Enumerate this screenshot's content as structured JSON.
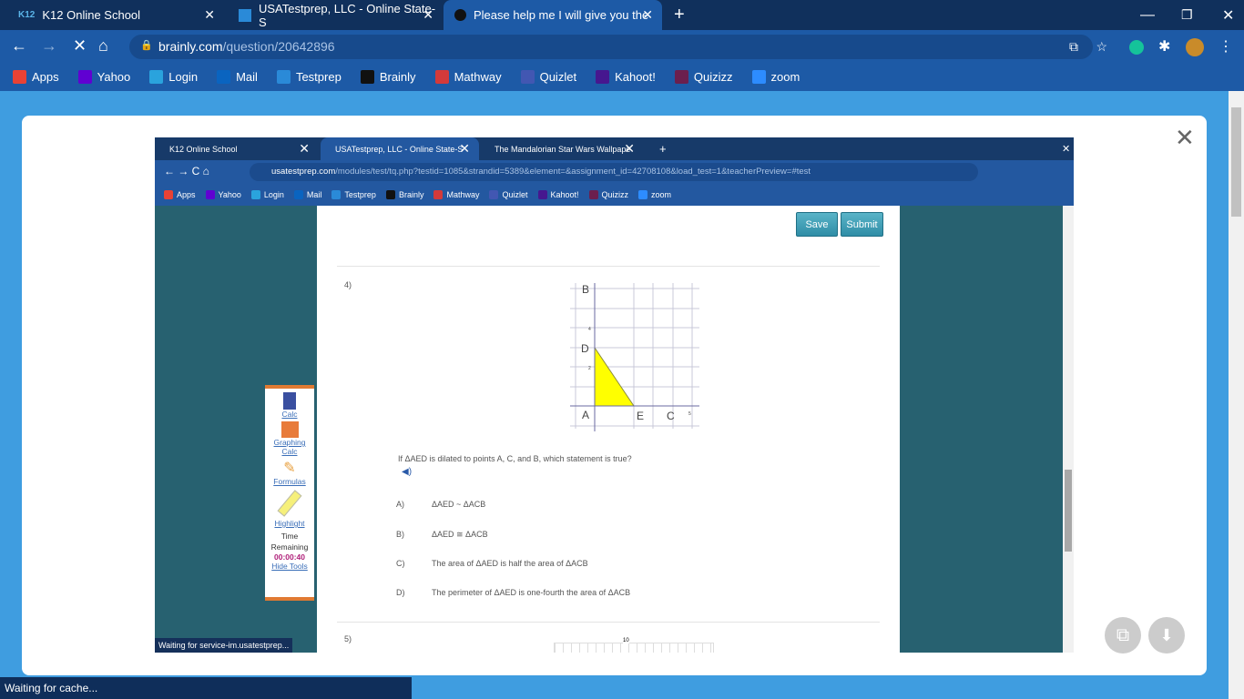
{
  "browser": {
    "tabs": [
      {
        "label": "K12 Online School",
        "icon": "K12"
      },
      {
        "label": "USATestprep, LLC - Online State-S"
      },
      {
        "label": "Please help me I will give you the",
        "active": true
      }
    ],
    "url_host": "brainly.com",
    "url_path": "/question/20642896",
    "bookmarks": [
      {
        "label": "Apps",
        "color": "#e94235"
      },
      {
        "label": "Yahoo",
        "color": "#6001d2"
      },
      {
        "label": "Login",
        "color": "#2aa3dd"
      },
      {
        "label": "Mail",
        "color": "#0a64c0"
      },
      {
        "label": "Testprep",
        "color": "#2a8ad8"
      },
      {
        "label": "Brainly",
        "color": "#111111"
      },
      {
        "label": "Mathway",
        "color": "#d33a3a"
      },
      {
        "label": "Quizlet",
        "color": "#4257b2"
      },
      {
        "label": "Kahoot!",
        "color": "#46178f"
      },
      {
        "label": "Quizizz",
        "color": "#6b1f4e"
      },
      {
        "label": "zoom",
        "color": "#2d8cff"
      }
    ],
    "status": "Waiting for cache..."
  },
  "screenshot": {
    "tabs": [
      {
        "label": "K12 Online School"
      },
      {
        "label": "USATestprep, LLC - Online State-S"
      },
      {
        "label": "The Mandalorian Star Wars Wallpape"
      }
    ],
    "url_host": "usatestprep.com",
    "url_path": "/modules/test/tq.php?testid=1085&strandid=5389&element=&assignment_id=42708108&load_test=1&teacherPreview=#test",
    "bookmarks": [
      "Apps",
      "Yahoo",
      "Login",
      "Mail",
      "Testprep",
      "Brainly",
      "Mathway",
      "Quizlet",
      "Kahoot!",
      "Quizizz",
      "zoom"
    ],
    "save": "Save",
    "submit": "Submit",
    "q_number": "4)",
    "graph": {
      "points": {
        "A": "A",
        "B": "B",
        "C": "C",
        "D": "D",
        "E": "E"
      },
      "ticks": [
        "4",
        "2",
        "5"
      ]
    },
    "question": "If ΔAED is dilated to points A, C, and B, which statement is true?",
    "options": [
      {
        "letter": "A)",
        "text": "ΔAED ~ ΔACB"
      },
      {
        "letter": "B)",
        "text": "ΔAED ≅ ΔACB"
      },
      {
        "letter": "C)",
        "text": "The area of ΔAED is half the area of ΔACB"
      },
      {
        "letter": "D)",
        "text": "The perimeter of ΔAED is one-fourth the area of ΔACB"
      }
    ],
    "next_number": "5)",
    "next_tick": "10",
    "tools": {
      "calc": "Calc",
      "graphing1": "Graphing",
      "graphing2": "Calc",
      "formulas": "Formulas",
      "highlight": "Highlight",
      "time1": "Time",
      "time2": "Remaining",
      "timer": "00:00:40",
      "hide": "Hide Tools"
    },
    "status": "Waiting for service-im.usatestprep..."
  }
}
